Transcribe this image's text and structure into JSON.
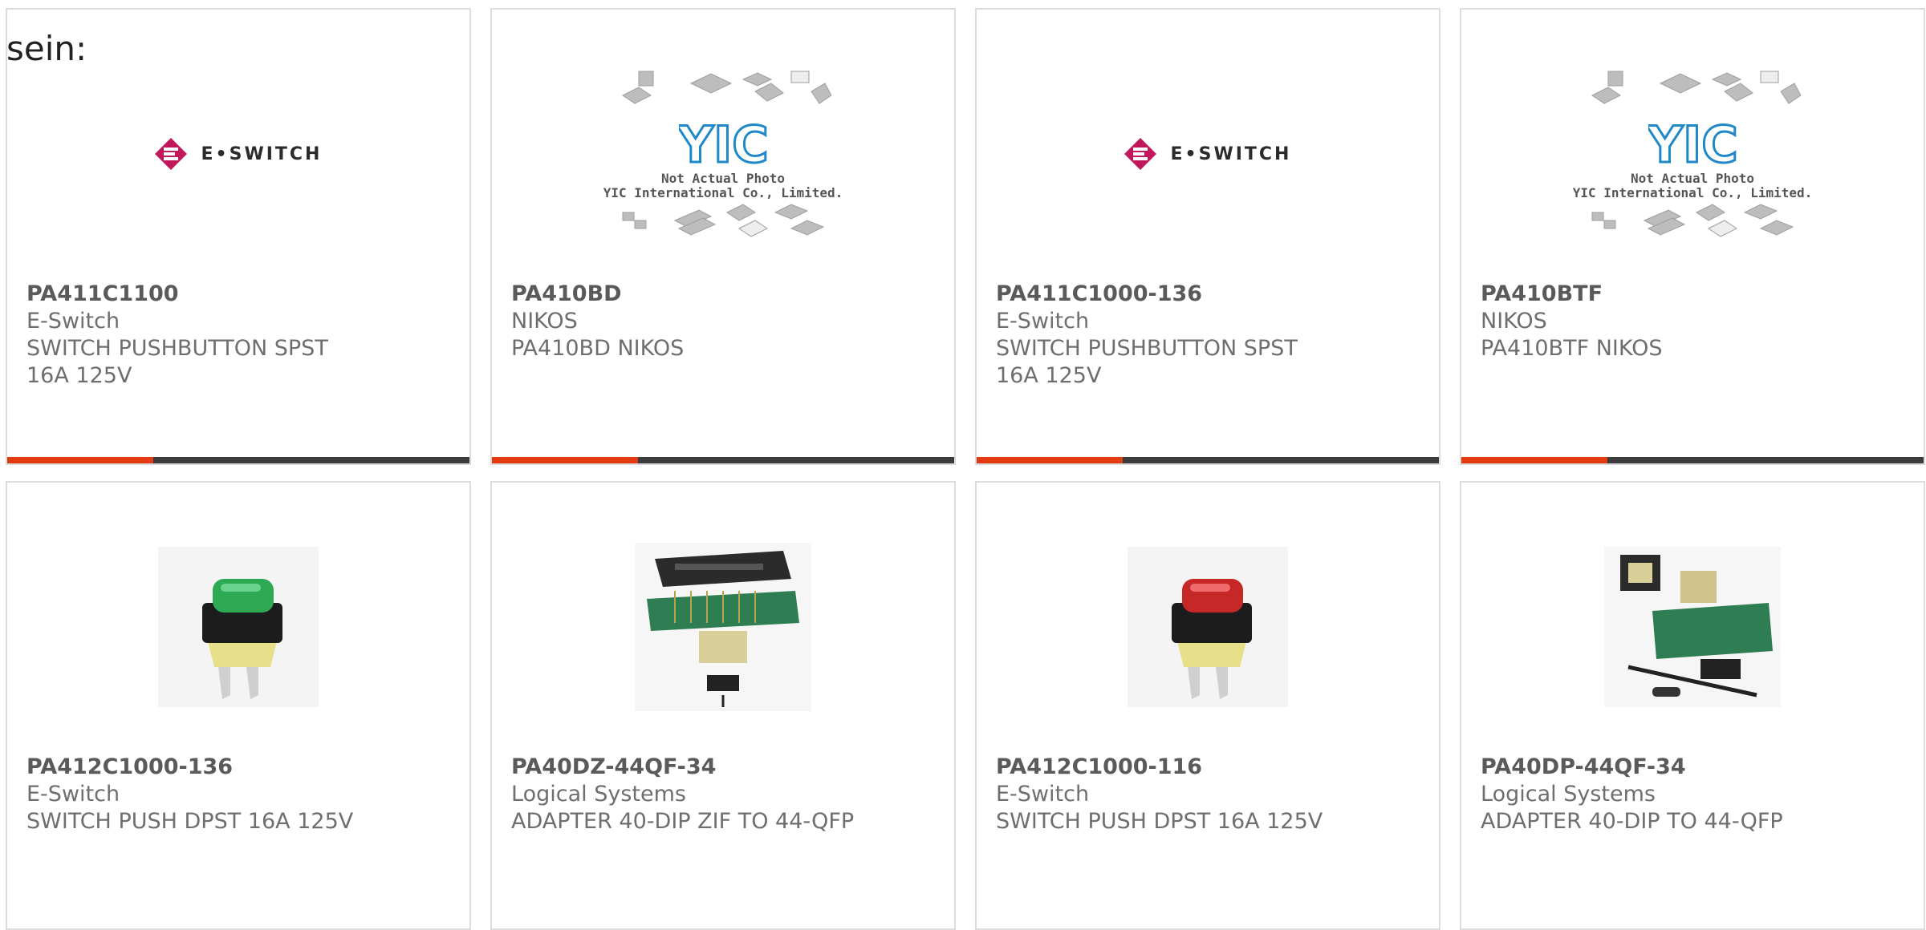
{
  "intro_text": "sein:",
  "colors": {
    "accent": "#e23b12",
    "bar": "#3c3c3c",
    "border": "#dcdcdc",
    "text": "#6e6e6e",
    "logo": "#c2185b"
  },
  "logo": {
    "eswitch_text": "E•SWITCH",
    "eswitch_mark": "®"
  },
  "placeholder": {
    "line1": "Not Actual Photo",
    "line2": "YIC International Co., Limited.",
    "brand": "YIC"
  },
  "products": [
    {
      "part": "PA411C1100",
      "mfr": "E-Switch",
      "desc": "SWITCH PUSHBUTTON SPST 16A 125V",
      "image": "eswitch-logo"
    },
    {
      "part": "PA410BD",
      "mfr": "NIKOS",
      "desc": "PA410BD NIKOS",
      "image": "yic-placeholder"
    },
    {
      "part": "PA411C1000-136",
      "mfr": "E-Switch",
      "desc": "SWITCH PUSHBUTTON SPST 16A 125V",
      "image": "eswitch-logo"
    },
    {
      "part": "PA410BTF",
      "mfr": "NIKOS",
      "desc": "PA410BTF NIKOS",
      "image": "yic-placeholder"
    },
    {
      "part": "PA412C1000-136",
      "mfr": "E-Switch",
      "desc": "SWITCH PUSH DPST 16A 125V",
      "image": "green-pushbutton"
    },
    {
      "part": "PA40DZ-44QF-34",
      "mfr": "Logical Systems",
      "desc": "ADAPTER 40-DIP ZIF TO 44-QFP",
      "image": "zif-adapter"
    },
    {
      "part": "PA412C1000-116",
      "mfr": "E-Switch",
      "desc": "SWITCH PUSH DPST 16A 125V",
      "image": "red-pushbutton"
    },
    {
      "part": "PA40DP-44QF-34",
      "mfr": "Logical Systems",
      "desc": "ADAPTER 40-DIP TO 44-QFP",
      "image": "dip-adapter"
    }
  ]
}
